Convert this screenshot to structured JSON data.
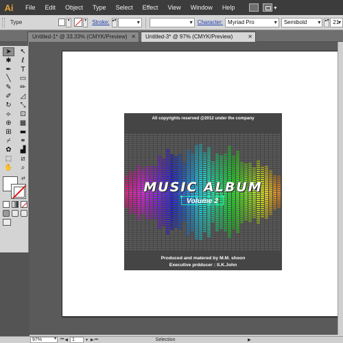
{
  "app": {
    "logo_text": "Ai"
  },
  "menubar": {
    "items": [
      "File",
      "Edit",
      "Object",
      "Type",
      "Select",
      "Effect",
      "View",
      "Window",
      "Help"
    ]
  },
  "controlbar": {
    "selection_type": "Type",
    "stroke_label": "Stroke:",
    "character_label": "Character:",
    "font_family": "Myriad Pro",
    "font_style": "Semibold",
    "font_size": "21"
  },
  "tabs": [
    {
      "label": "Untitled-1* @ 33.33% (CMYK/Preview)",
      "active": false
    },
    {
      "label": "Untitled-3* @ 97% (CMYK/Preview)",
      "active": true
    }
  ],
  "tools": {
    "items": [
      {
        "name": "selection-tool",
        "glyph": "➤",
        "selected": true
      },
      {
        "name": "direct-selection-tool",
        "glyph": "↖"
      },
      {
        "name": "magic-wand-tool",
        "glyph": "✱"
      },
      {
        "name": "lasso-tool",
        "glyph": "ℓ"
      },
      {
        "name": "pen-tool",
        "glyph": "✒"
      },
      {
        "name": "type-tool",
        "glyph": "T"
      },
      {
        "name": "line-tool",
        "glyph": "╲"
      },
      {
        "name": "rectangle-tool",
        "glyph": "▭"
      },
      {
        "name": "paintbrush-tool",
        "glyph": "✎"
      },
      {
        "name": "pencil-tool",
        "glyph": "✏"
      },
      {
        "name": "blob-brush-tool",
        "glyph": "✐"
      },
      {
        "name": "eraser-tool",
        "glyph": "◿"
      },
      {
        "name": "rotate-tool",
        "glyph": "↻"
      },
      {
        "name": "scale-tool",
        "glyph": "⤡"
      },
      {
        "name": "width-tool",
        "glyph": "⟣"
      },
      {
        "name": "free-transform-tool",
        "glyph": "⊡"
      },
      {
        "name": "shape-builder-tool",
        "glyph": "⊕"
      },
      {
        "name": "perspective-grid-tool",
        "glyph": "▦"
      },
      {
        "name": "mesh-tool",
        "glyph": "⊞"
      },
      {
        "name": "gradient-tool",
        "glyph": "▬"
      },
      {
        "name": "eyedropper-tool",
        "glyph": "⌿"
      },
      {
        "name": "blend-tool",
        "glyph": "⚭"
      },
      {
        "name": "symbol-sprayer-tool",
        "glyph": "✿"
      },
      {
        "name": "column-graph-tool",
        "glyph": "▟"
      },
      {
        "name": "artboard-tool",
        "glyph": "⬚"
      },
      {
        "name": "slice-tool",
        "glyph": "⧄"
      },
      {
        "name": "hand-tool",
        "glyph": "✋"
      },
      {
        "name": "zoom-tool",
        "glyph": "⌕"
      }
    ]
  },
  "artwork": {
    "copyright": "All copyrights reserved @2012 under the company",
    "title": "MUSIC ALBUM",
    "volume": "Volume 2",
    "produced": "Produced and matered by M.M. shoon",
    "executive": "Executive prdducer : S.K.John"
  },
  "statusbar": {
    "zoom": "97%",
    "page": "1",
    "status_text": "Selection"
  },
  "colors": {
    "menubar_bg": "#3c3c3c",
    "panel_bg": "#d6d6d6",
    "canvas_bg": "#5a5a5a",
    "cover_bg": "#454545",
    "selection_accent": "#2be0b4"
  }
}
